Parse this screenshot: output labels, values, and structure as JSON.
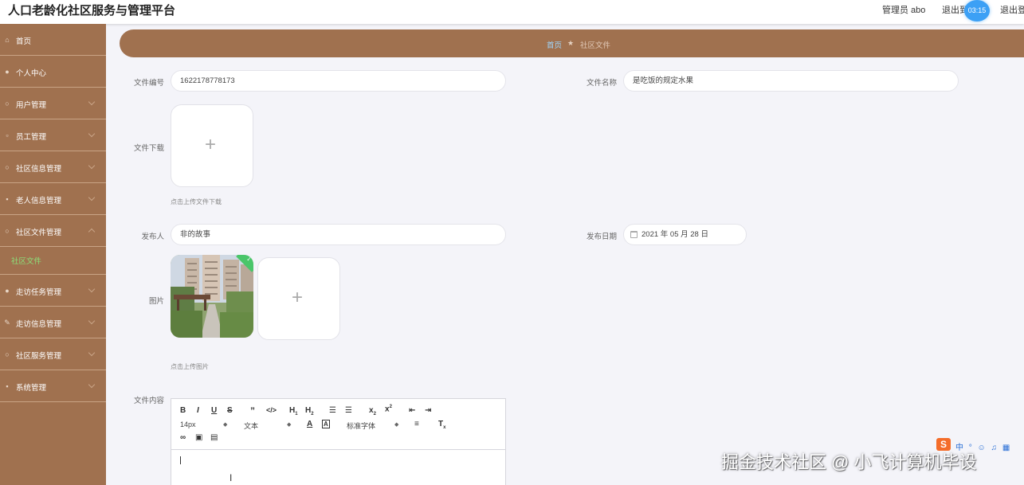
{
  "header": {
    "app_title": "人口老龄化社区服务与管理平台",
    "user_label": "管理员 abo",
    "exit_label_1": "退出到前台",
    "exit_label_2": "退出登录",
    "timer": "03:15"
  },
  "sidebar": {
    "items": [
      {
        "label": "首页",
        "icon": "home-icon"
      },
      {
        "label": "个人中心",
        "icon": "user-icon"
      },
      {
        "label": "用户管理",
        "icon": "users-icon"
      },
      {
        "label": "员工管理",
        "icon": "staff-icon"
      },
      {
        "label": "社区信息管理",
        "icon": "info-icon"
      },
      {
        "label": "老人信息管理",
        "icon": "elder-icon"
      },
      {
        "label": "社区文件管理",
        "icon": "file-icon"
      },
      {
        "label": "走访任务管理",
        "icon": "task-icon"
      },
      {
        "label": "走访信息管理",
        "icon": "visit-icon"
      },
      {
        "label": "社区服务管理",
        "icon": "service-icon"
      },
      {
        "label": "系统管理",
        "icon": "system-icon"
      }
    ],
    "active_sub": "社区文件"
  },
  "breadcrumb": {
    "home": "首页",
    "current": "社区文件"
  },
  "form": {
    "file_no_label": "文件编号",
    "file_no_value": "1622178778173",
    "file_name_label": "文件名称",
    "file_name_value": "是吃饭的规定水果",
    "download_label": "文件下载",
    "download_hint": "点击上传文件下载",
    "publisher_label": "发布人",
    "publisher_value": "非的故事",
    "date_label": "发布日期",
    "date_value": "2021 年 05 月 28 日",
    "image_label": "图片",
    "image_hint": "点击上传图片",
    "content_label": "文件内容"
  },
  "editor": {
    "font_size": "14px",
    "paragraph": "文本",
    "font_family": "标准字体"
  },
  "watermark": "掘金技术社区 @ 小飞计算机毕设",
  "ime": {
    "logo": "S",
    "status": "中"
  }
}
